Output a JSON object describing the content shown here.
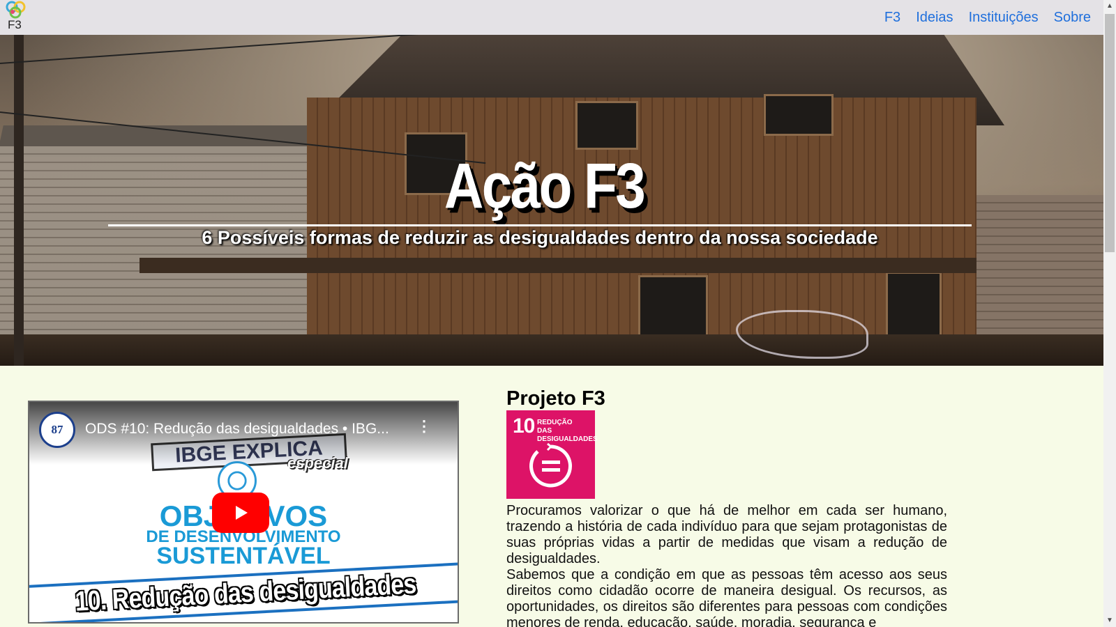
{
  "header": {
    "logo_text": "F3",
    "nav": [
      {
        "label": "F3"
      },
      {
        "label": "Ideias"
      },
      {
        "label": "Instituições"
      },
      {
        "label": "Sobre"
      }
    ]
  },
  "hero": {
    "title": "Ação F3",
    "subtitle": "6 Possíveis formas de reduzir as desigualdades dentro da nossa sociedade"
  },
  "video": {
    "channel_avatar_text": "87",
    "title": "ODS #10: Redução das desigualdades • IBG...",
    "thumbnail": {
      "banner": "IBGE EXPLICA",
      "banner_tag": "especial",
      "line1": "OBJETIVOS",
      "line2": "DE DESENVOLVIMENTO",
      "line3": "SUSTENTÁVEL",
      "caption": "10. Redução das desigualdades"
    }
  },
  "article": {
    "heading": "Projeto F3",
    "sdg_badge": {
      "number": "10",
      "label": "REDUÇÃO DAS DESIGUALDADES",
      "color": "#dd1367"
    },
    "paragraphs": [
      "Procuramos valorizar o que há de melhor em cada ser humano, trazendo a história de cada indivíduo para que sejam protagonistas de suas próprias vidas a partir de medidas que visam a redução de desigualdades.",
      "Sabemos que a condição em que as pessoas têm acesso aos seus direitos como cidadão ocorre de maneira desigual. Os recursos, as oportunidades, os direitos são diferentes para pessoas com condições menores de renda, educação, saúde, moradia, segurança e"
    ]
  },
  "colors": {
    "nav_link": "#1f6fdc",
    "topbar_bg": "#e4e2e6",
    "page_bg": "#f7fbe7",
    "play_button": "#ff0000"
  }
}
